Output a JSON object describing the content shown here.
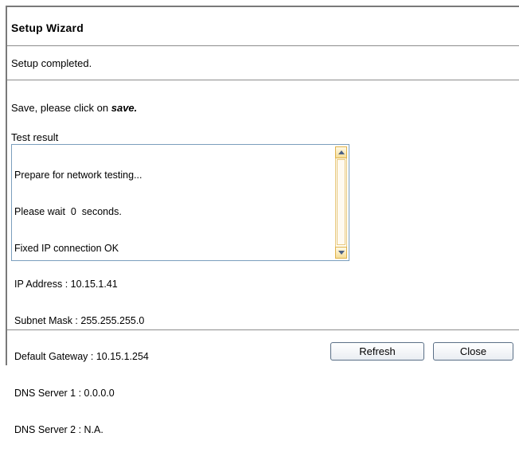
{
  "wizard": {
    "title": "Setup Wizard",
    "status": "Setup completed.",
    "instruction_prefix": "Save, please click on ",
    "instruction_action": "save.",
    "test_result_label": "Test result",
    "test_result_lines": [
      "Prepare for network testing...",
      "Please wait  0  seconds.",
      "Fixed IP connection OK",
      "IP Address : 10.15.1.41",
      "Subnet Mask : 255.255.255.0",
      "Default Gateway : 10.15.1.254",
      "DNS Server 1 : 0.0.0.0",
      "DNS Server 2 : N.A."
    ],
    "buttons": {
      "refresh": "Refresh",
      "close": "Close"
    }
  },
  "colors": {
    "border": "#7a7a7a",
    "textarea_border": "#7b9ebd",
    "scrollbar_accent": "#e0b24a",
    "button_border": "#5a6f86"
  },
  "icons": {
    "scroll_up": "arrow-up-icon",
    "scroll_down": "arrow-down-icon"
  }
}
